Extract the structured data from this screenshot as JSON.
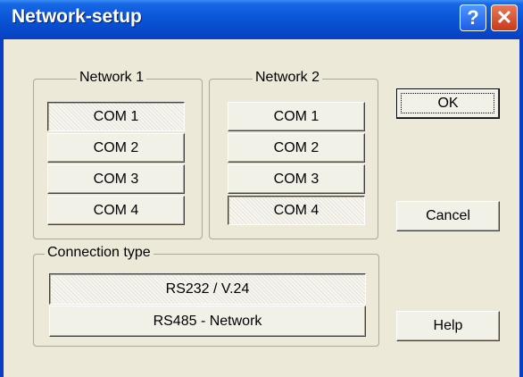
{
  "window": {
    "title": "Network-setup",
    "help_glyph": "?",
    "close_glyph": "✕"
  },
  "network1": {
    "label": "Network 1",
    "ports": [
      "COM 1",
      "COM 2",
      "COM 3",
      "COM 4"
    ],
    "selected": "COM 1"
  },
  "network2": {
    "label": "Network 2",
    "ports": [
      "COM 1",
      "COM 2",
      "COM 3",
      "COM 4"
    ],
    "selected": "COM 4"
  },
  "connection": {
    "label": "Connection type",
    "options": [
      "RS232 / V.24",
      "RS485 - Network"
    ],
    "selected": "RS232 / V.24"
  },
  "buttons": {
    "ok": "OK",
    "cancel": "Cancel",
    "help": "Help"
  }
}
